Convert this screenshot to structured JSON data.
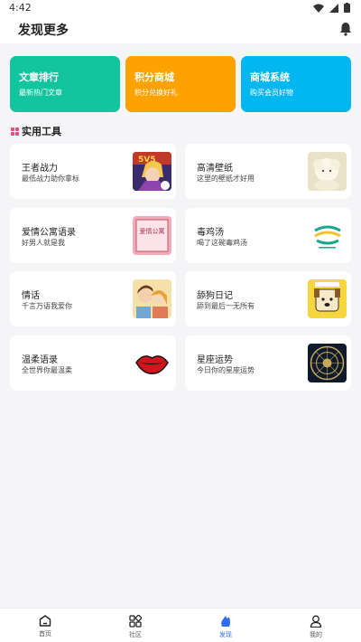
{
  "status": {
    "time": "4:42"
  },
  "header": {
    "title": "发现更多"
  },
  "banners": [
    {
      "title": "文章排行",
      "subtitle": "最新热门文章",
      "color": "#12c59e"
    },
    {
      "title": "积分商城",
      "subtitle": "积分兑换好礼",
      "color": "#ffa200"
    },
    {
      "title": "商城系统",
      "subtitle": "购买会员好物",
      "color": "#00b7f0"
    }
  ],
  "section": {
    "title": "实用工具"
  },
  "tools": [
    {
      "title": "王者战力",
      "subtitle": "最低战力助你拿标",
      "icon": "hero-portrait-icon"
    },
    {
      "title": "高清壁纸",
      "subtitle": "这里的壁纸才好用",
      "icon": "plush-sheep-icon"
    },
    {
      "title": "爱情公寓语录",
      "subtitle": "好男人就是我",
      "icon": "love-apartment-poster-icon",
      "thumb_text": "爱情公寓"
    },
    {
      "title": "毒鸡汤",
      "subtitle": "喝了这碗毒鸡汤",
      "icon": "soup-logo-icon"
    },
    {
      "title": "情话",
      "subtitle": "千言万语我爱你",
      "icon": "couple-illustration-icon"
    },
    {
      "title": "舔狗日记",
      "subtitle": "舔到最后一无所有",
      "icon": "dog-cartoon-icon"
    },
    {
      "title": "温柔语录",
      "subtitle": "全世界你最温柔",
      "icon": "red-lips-icon"
    },
    {
      "title": "星座运势",
      "subtitle": "今日你的星座运势",
      "icon": "zodiac-wheel-icon"
    }
  ],
  "tabs": [
    {
      "label": "首页",
      "icon": "home-icon"
    },
    {
      "label": "社区",
      "icon": "apps-grid-icon"
    },
    {
      "label": "发现",
      "icon": "discover-icon",
      "active": true
    },
    {
      "label": "我的",
      "icon": "profile-icon"
    }
  ],
  "colors": {
    "accent": "#2e6cf0",
    "section_icon": "#e84d7a"
  }
}
